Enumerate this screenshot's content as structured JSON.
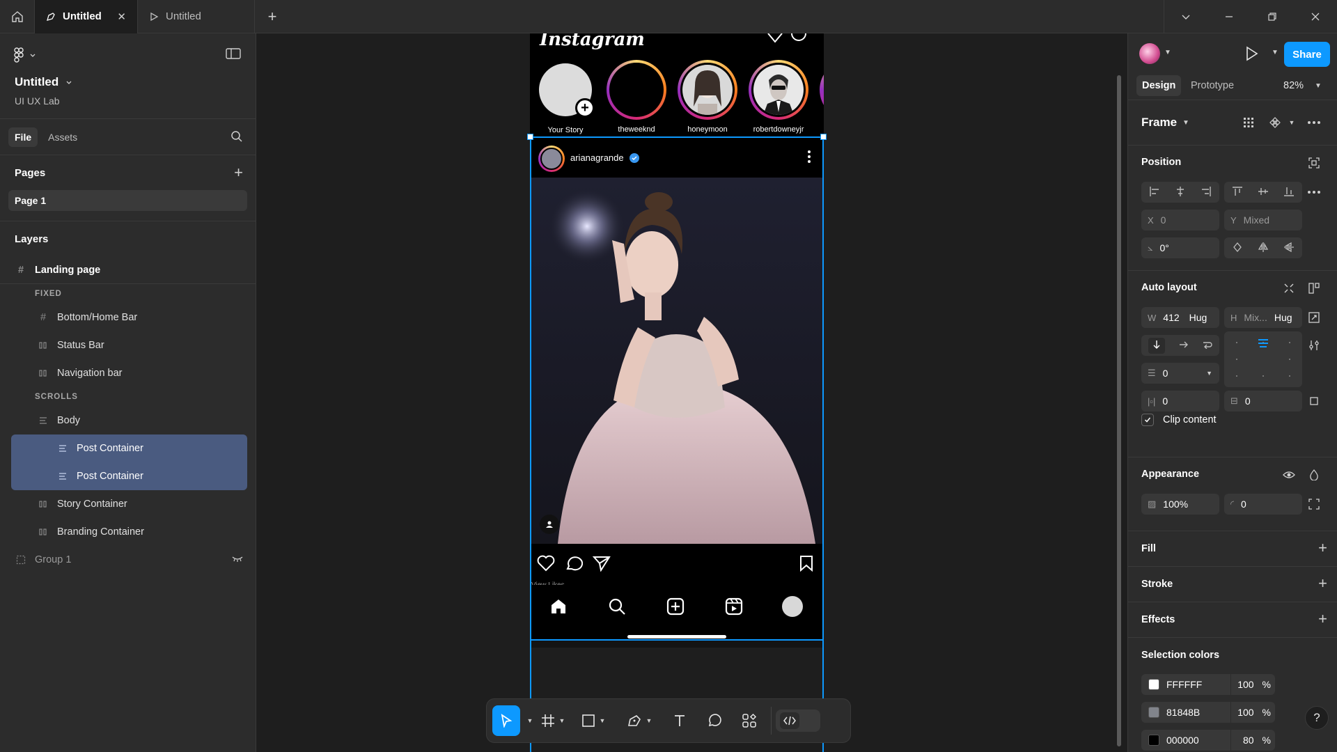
{
  "tabs": [
    {
      "label": "Untitled",
      "active": true
    },
    {
      "label": "Untitled",
      "active": false
    }
  ],
  "file": {
    "title": "Untitled",
    "team": "UI UX Lab"
  },
  "file_tabs": [
    "File",
    "Assets"
  ],
  "pages": {
    "heading": "Pages",
    "items": [
      "Page 1"
    ]
  },
  "layers": {
    "heading": "Layers",
    "root": "Landing page",
    "fixed_label": "FIXED",
    "fixed": [
      "Bottom/Home Bar",
      "Status Bar",
      "Navigation bar"
    ],
    "scrolls_label": "SCROLLS",
    "body": "Body",
    "selected": [
      "Post Container",
      "Post Container"
    ],
    "others": [
      "Story Container",
      "Branding Container"
    ],
    "group": "Group 1"
  },
  "phone": {
    "logo": "Instagram",
    "stories": [
      {
        "name": "Your Story"
      },
      {
        "name": "theweeknd"
      },
      {
        "name": "honeymoon"
      },
      {
        "name": "robertdowneyjr"
      }
    ],
    "post_user": "arianagrande",
    "likes_text": "View Likes"
  },
  "right": {
    "share": "Share",
    "mode_tabs": [
      "Design",
      "Prototype"
    ],
    "zoom": "82%",
    "selection": "Frame",
    "position": {
      "title": "Position",
      "x_label": "X",
      "x": "0",
      "y_label": "Y",
      "y": "Mixed",
      "rotation": "0°"
    },
    "auto_layout": {
      "title": "Auto layout",
      "w_label": "W",
      "w": "412",
      "w_mode": "Hug",
      "h_label": "H",
      "h": "Mix...",
      "h_mode": "Hug",
      "gap": "0",
      "pad_h": "0",
      "pad_v": "0",
      "clip": "Clip content"
    },
    "appearance": {
      "title": "Appearance",
      "opacity": "100%",
      "radius": "0"
    },
    "fill": "Fill",
    "stroke": "Stroke",
    "effects": "Effects",
    "selection_colors": {
      "title": "Selection colors",
      "items": [
        {
          "hex": "FFFFFF",
          "opacity": "100",
          "unit": "%",
          "color": "#FFFFFF"
        },
        {
          "hex": "81848B",
          "opacity": "100",
          "unit": "%",
          "color": "#81848B"
        },
        {
          "hex": "000000",
          "opacity": "80",
          "unit": "%",
          "color": "#000000"
        }
      ]
    }
  },
  "colors": {
    "accent": "#0d99ff",
    "selected_layer": "#4a5b80"
  }
}
